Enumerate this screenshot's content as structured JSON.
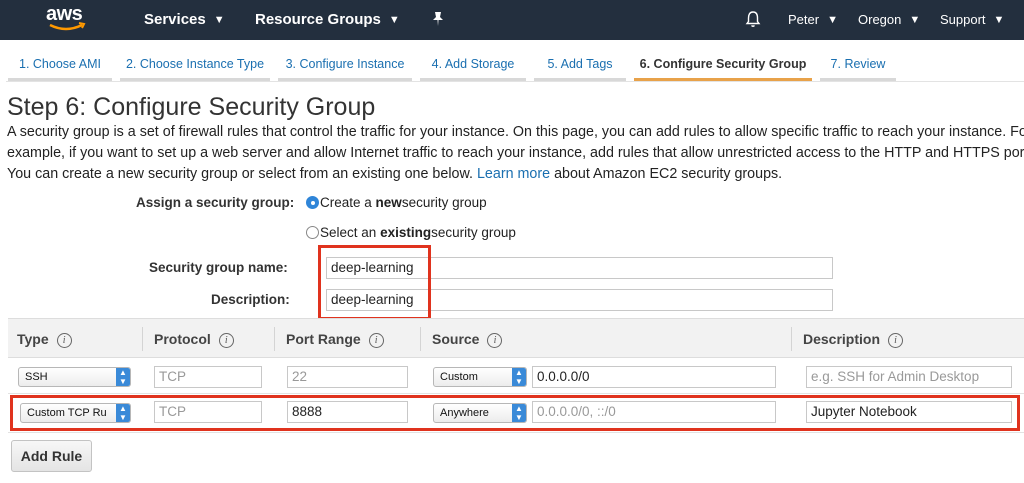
{
  "topnav": {
    "logo_text": "aws",
    "services": "Services",
    "resource_groups": "Resource Groups",
    "user": "Peter",
    "region": "Oregon",
    "support": "Support"
  },
  "tabs": [
    {
      "label": "1. Choose AMI"
    },
    {
      "label": "2. Choose Instance Type"
    },
    {
      "label": "3. Configure Instance"
    },
    {
      "label": "4. Add Storage"
    },
    {
      "label": "5. Add Tags"
    },
    {
      "label": "6. Configure Security Group"
    },
    {
      "label": "7. Review"
    }
  ],
  "page": {
    "title": "Step 6: Configure Security Group",
    "intro_line1": "A security group is a set of firewall rules that control the traffic for your instance. On this page, you can add rules to allow specific traffic to reach your instance. For",
    "intro_line2": "example, if you want to set up a web server and allow Internet traffic to reach your instance, add rules that allow unrestricted access to the HTTP and HTTPS ports.",
    "intro_line3_a": "You can create a new security group or select from an existing one below.",
    "learn_more": "Learn more",
    "intro_line3_b": "about Amazon EC2 security groups."
  },
  "form": {
    "assign_label": "Assign a security group:",
    "create_a": "Create a ",
    "create_b": "new",
    "create_c": " security group",
    "select_a": "Select an ",
    "select_b": "existing",
    "select_c": " security group",
    "name_label": "Security group name:",
    "name_value": "deep-learning",
    "desc_label": "Description:",
    "desc_value": "deep-learning"
  },
  "table": {
    "headers": {
      "type": "Type",
      "protocol": "Protocol",
      "port_range": "Port Range",
      "source": "Source",
      "description": "Description"
    },
    "info_glyph": "i",
    "rows": [
      {
        "type": "SSH",
        "protocol": "TCP",
        "port_range": "22",
        "source_select": "Custom",
        "source_value": "0.0.0.0/0",
        "description_placeholder": "e.g. SSH for Admin Desktop"
      },
      {
        "type": "Custom TCP Ru",
        "protocol": "TCP",
        "port_range": "8888",
        "source_select": "Anywhere",
        "source_value": "0.0.0.0/0, ::/0",
        "description": "Jupyter Notebook"
      }
    ]
  },
  "buttons": {
    "add_rule": "Add Rule"
  },
  "colors": {
    "nav_bg": "#232f3e",
    "link": "#1a6fb0",
    "active_tab": "#e8a24a",
    "highlight": "#e0331e",
    "select_accent": "#3a8ad8"
  }
}
